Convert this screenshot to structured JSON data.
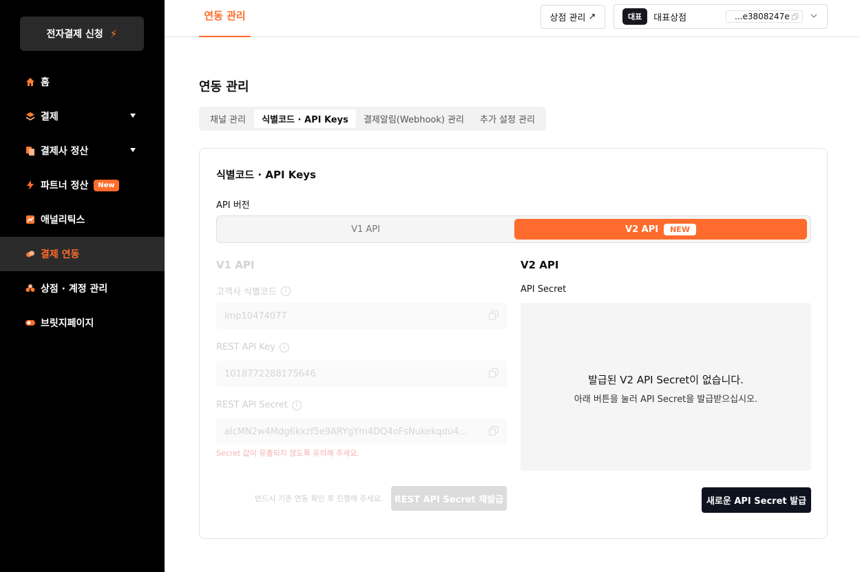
{
  "sidebar": {
    "apply_button": "전자결제 신청",
    "items": [
      {
        "label": "홈",
        "icon": "home-icon"
      },
      {
        "label": "결제",
        "icon": "layers-icon"
      },
      {
        "label": "결제사 정산",
        "icon": "documents-icon"
      },
      {
        "label": "파트너 정산",
        "icon": "bolt-icon",
        "badge": "New"
      },
      {
        "label": "애널리틱스",
        "icon": "chart-icon"
      },
      {
        "label": "결제 연동",
        "icon": "link-icon",
        "active": true
      },
      {
        "label": "상점 · 계정 관리",
        "icon": "users-icon"
      },
      {
        "label": "브릿지페이지",
        "icon": "toggle-icon"
      }
    ]
  },
  "topbar": {
    "tab": "연동 관리",
    "store_manage": "상점 관리",
    "store_manage_arrow": "↗",
    "rep_badge": "대표",
    "store_name": "대표상점",
    "store_id": "...e3808247e"
  },
  "page": {
    "title": "연동 관리",
    "tabs": [
      "채널 관리",
      "식별코드 · API Keys",
      "결제알림(Webhook) 관리",
      "추가 설정 관리"
    ],
    "active_tab": 1
  },
  "card": {
    "title": "식별코드 · API Keys",
    "version_label": "API 버전",
    "v1_option": "V1 API",
    "v2_option": "V2 API",
    "v2_badge": "NEW",
    "v1": {
      "heading": "V1 API",
      "fields": [
        {
          "label": "고객사 식별코드",
          "value": "imp10474077"
        },
        {
          "label": "REST API Key",
          "value": "1018772288175646"
        },
        {
          "label": "REST API Secret",
          "value": "alcMN2w4Mdg6kxzf5e9ARYgYm4DQ4oFsNukekqdu4..."
        }
      ],
      "warning": "Secret 값이 유출되지 않도록 유의해 주세요.",
      "reissue_note": "반드시 기존 연동 확인 후 진행해 주세요.",
      "reissue_button": "REST API Secret 재발급"
    },
    "v2": {
      "heading": "V2 API",
      "label": "API Secret",
      "empty_title": "발급된 V2 API Secret이 없습니다.",
      "empty_sub": "아래 버튼을 눌러 API Secret을 발급받으십시오.",
      "issue_button": "새로운 API Secret 발급"
    }
  },
  "colors": {
    "accent": "#ff6b2c",
    "sidebar_bg": "#000000",
    "dark_button": "#0f1320"
  }
}
